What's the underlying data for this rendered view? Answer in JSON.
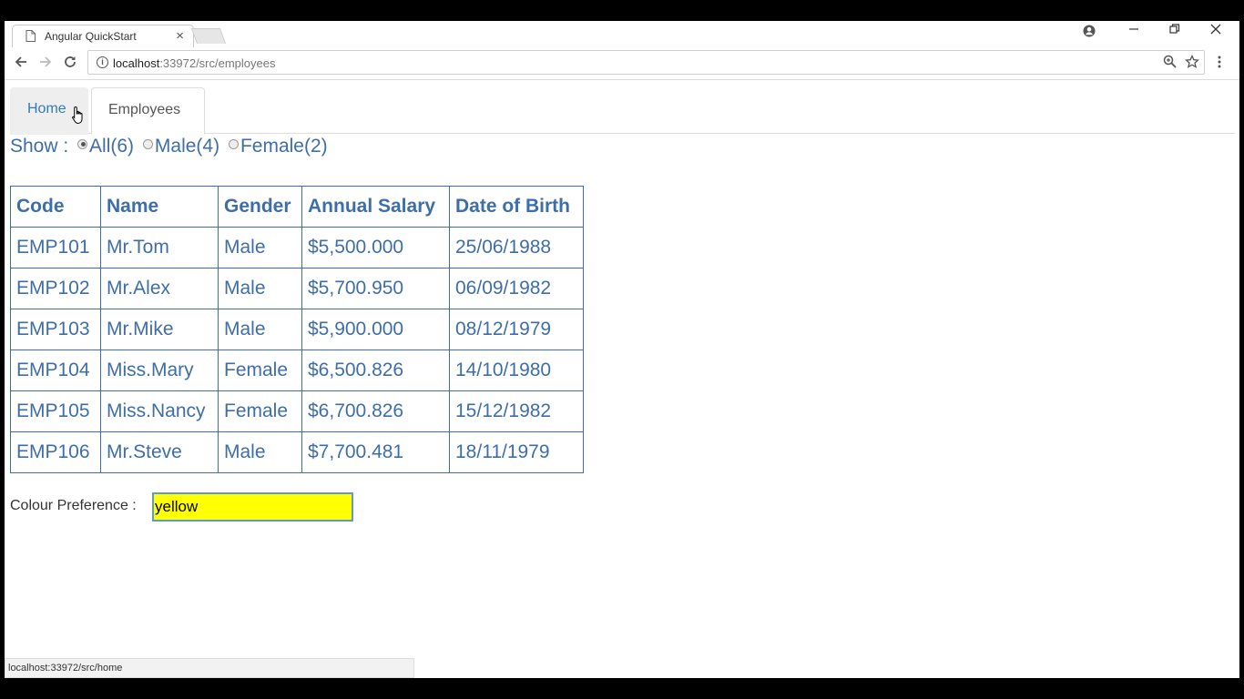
{
  "browser": {
    "tab_title": "Angular QuickStart",
    "tab_close": "×",
    "url_host": "localhost",
    "url_path": ":33972/src/employees",
    "status_url": "localhost:33972/src/home"
  },
  "nav": {
    "home_label": "Home",
    "employees_label": "Employees"
  },
  "filter": {
    "label": "Show :",
    "options": [
      {
        "label": "All(6)",
        "checked": true
      },
      {
        "label": "Male(4)",
        "checked": false
      },
      {
        "label": "Female(2)",
        "checked": false
      }
    ]
  },
  "table": {
    "headers": [
      "Code",
      "Name",
      "Gender",
      "Annual Salary",
      "Date of Birth"
    ],
    "rows": [
      [
        "EMP101",
        "Mr.Tom",
        "Male",
        "$5,500.000",
        "25/06/1988"
      ],
      [
        "EMP102",
        "Mr.Alex",
        "Male",
        "$5,700.950",
        "06/09/1982"
      ],
      [
        "EMP103",
        "Mr.Mike",
        "Male",
        "$5,900.000",
        "08/12/1979"
      ],
      [
        "EMP104",
        "Miss.Mary",
        "Female",
        "$6,500.826",
        "14/10/1980"
      ],
      [
        "EMP105",
        "Miss.Nancy",
        "Female",
        "$6,700.826",
        "15/12/1982"
      ],
      [
        "EMP106",
        "Mr.Steve",
        "Male",
        "$7,700.481",
        "18/11/1979"
      ]
    ]
  },
  "colour": {
    "label": "Colour Preference :",
    "value": "yellow",
    "input_bg": "#ffff00"
  },
  "colors": {
    "link_blue": "#3e6ea9",
    "nav_link": "#337ab7"
  }
}
